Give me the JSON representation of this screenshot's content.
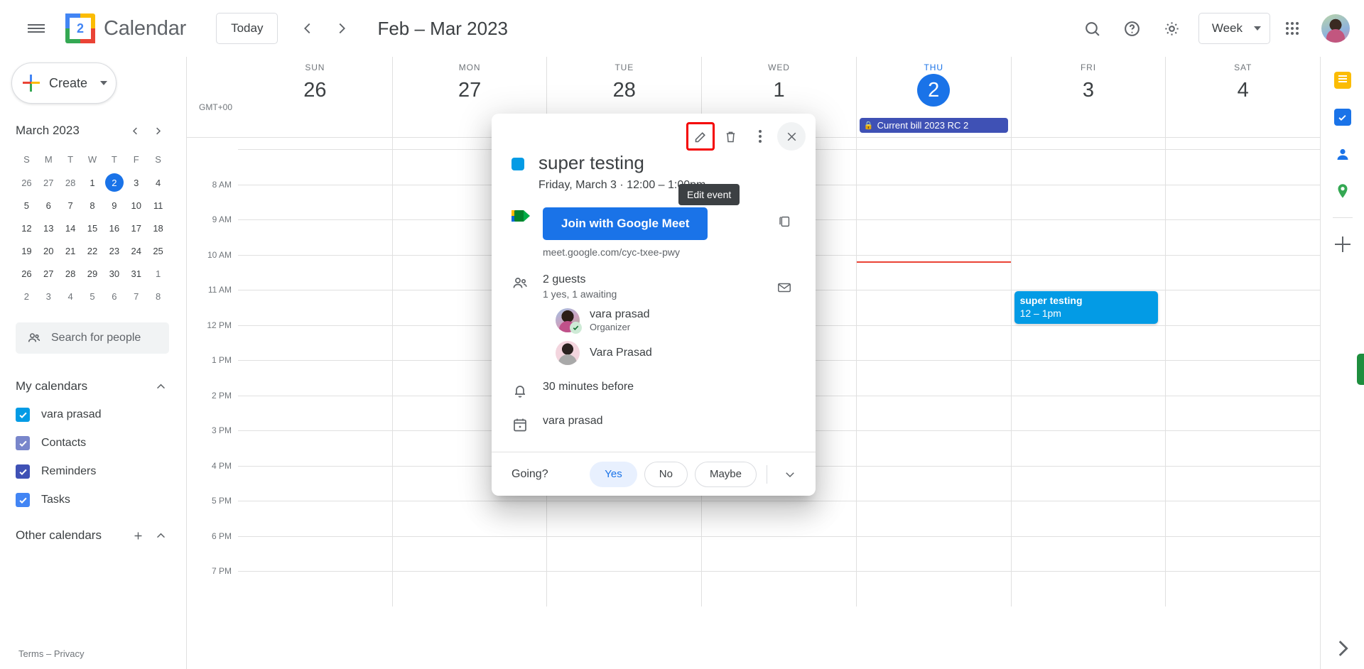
{
  "topbar": {
    "menu_icon": "hamburger-menu-icon",
    "logo_day": "2",
    "brand": "Calendar",
    "today_label": "Today",
    "prev_icon": "chevron-left-icon",
    "next_icon": "chevron-right-icon",
    "range_title": "Feb – Mar 2023",
    "search_icon": "search-icon",
    "help_icon": "help-icon",
    "settings_icon": "gear-icon",
    "view_label": "Week",
    "apps_icon": "apps-grid-icon",
    "avatar": "user-avatar"
  },
  "sidebar": {
    "create_label": "Create",
    "mini_calendar": {
      "title": "March 2023",
      "prev_icon": "chevron-left-icon",
      "next_icon": "chevron-right-icon",
      "dow": [
        "S",
        "M",
        "T",
        "W",
        "T",
        "F",
        "S"
      ],
      "weeks": [
        [
          {
            "d": "26",
            "muted": true
          },
          {
            "d": "27",
            "muted": true
          },
          {
            "d": "28",
            "muted": true
          },
          {
            "d": "1"
          },
          {
            "d": "2",
            "sel": true
          },
          {
            "d": "3"
          },
          {
            "d": "4"
          }
        ],
        [
          {
            "d": "5"
          },
          {
            "d": "6"
          },
          {
            "d": "7"
          },
          {
            "d": "8"
          },
          {
            "d": "9"
          },
          {
            "d": "10"
          },
          {
            "d": "11"
          }
        ],
        [
          {
            "d": "12"
          },
          {
            "d": "13"
          },
          {
            "d": "14"
          },
          {
            "d": "15"
          },
          {
            "d": "16"
          },
          {
            "d": "17"
          },
          {
            "d": "18"
          }
        ],
        [
          {
            "d": "19"
          },
          {
            "d": "20"
          },
          {
            "d": "21"
          },
          {
            "d": "22"
          },
          {
            "d": "23"
          },
          {
            "d": "24"
          },
          {
            "d": "25"
          }
        ],
        [
          {
            "d": "26"
          },
          {
            "d": "27"
          },
          {
            "d": "28"
          },
          {
            "d": "29"
          },
          {
            "d": "30"
          },
          {
            "d": "31"
          },
          {
            "d": "1",
            "muted": true
          }
        ],
        [
          {
            "d": "2",
            "muted": true
          },
          {
            "d": "3",
            "muted": true
          },
          {
            "d": "4",
            "muted": true
          },
          {
            "d": "5",
            "muted": true
          },
          {
            "d": "6",
            "muted": true
          },
          {
            "d": "7",
            "muted": true
          },
          {
            "d": "8",
            "muted": true
          }
        ]
      ]
    },
    "search_people_placeholder": "Search for people",
    "search_people_icon": "people-icon",
    "my_calendars": {
      "title": "My calendars",
      "collapse_icon": "chevron-up-icon",
      "items": [
        {
          "label": "vara prasad",
          "color": "#039be5"
        },
        {
          "label": "Contacts",
          "color": "#7986cb"
        },
        {
          "label": "Reminders",
          "color": "#3f51b5"
        },
        {
          "label": "Tasks",
          "color": "#4285f4"
        }
      ]
    },
    "other_calendars": {
      "title": "Other calendars",
      "add_icon": "plus-icon",
      "collapse_icon": "chevron-up-icon"
    },
    "terms": "Terms – Privacy"
  },
  "week_view": {
    "timezone": "GMT+00",
    "days": [
      {
        "dow": "SUN",
        "num": "26"
      },
      {
        "dow": "MON",
        "num": "27"
      },
      {
        "dow": "TUE",
        "num": "28"
      },
      {
        "dow": "WED",
        "num": "1"
      },
      {
        "dow": "THU",
        "num": "2",
        "today": true
      },
      {
        "dow": "FRI",
        "num": "3"
      },
      {
        "dow": "SAT",
        "num": "4"
      }
    ],
    "time_labels": [
      "8 AM",
      "9 AM",
      "10 AM",
      "11 AM",
      "12 PM",
      "1 PM",
      "2 PM",
      "3 PM",
      "4 PM",
      "5 PM",
      "6 PM",
      "7 PM"
    ],
    "allday_event": {
      "title": "Current bill 2023  RC 2",
      "lock_icon": "lock-icon",
      "color": "#3f51b5",
      "day_index": 4
    },
    "events": [
      {
        "title": "super testing",
        "time": "12 – 1pm",
        "color": "#039be5",
        "day_index": 5
      }
    ]
  },
  "rail": {
    "keep_icon": "google-keep-icon",
    "tasks_icon": "google-tasks-icon",
    "contacts_icon": "google-contacts-icon",
    "maps_icon": "google-maps-icon",
    "add_icon": "add-addon-icon",
    "expand_icon": "expand-panel-icon"
  },
  "popup": {
    "edit_icon": "pencil-edit-icon",
    "delete_icon": "trash-delete-icon",
    "more_icon": "more-options-icon",
    "close_icon": "close-icon",
    "tooltip": "Edit event",
    "color": "#039be5",
    "title": "super testing",
    "when": "Friday, March 3  ·  12:00 – 1:00pm",
    "meet_icon": "google-meet-icon",
    "meet_button": "Join with Google Meet",
    "meet_link": "meet.google.com/cyc-txee-pwy",
    "copy_icon": "copy-icon",
    "guests_icon": "people-icon",
    "guests_title": "2 guests",
    "guests_sub": "1 yes, 1 awaiting",
    "email_icon": "email-icon",
    "guests": [
      {
        "name": "vara prasad",
        "role": "Organizer",
        "accepted": true
      },
      {
        "name": "Vara Prasad",
        "role": "",
        "accepted": false
      }
    ],
    "notification_icon": "bell-icon",
    "notification": "30 minutes before",
    "calendar_icon": "calendar-icon",
    "calendar_owner": "vara prasad",
    "going_label": "Going?",
    "rsvp": [
      {
        "label": "Yes",
        "selected": true
      },
      {
        "label": "No",
        "selected": false
      },
      {
        "label": "Maybe",
        "selected": false
      }
    ],
    "rsvp_more_icon": "chevron-down-icon"
  }
}
